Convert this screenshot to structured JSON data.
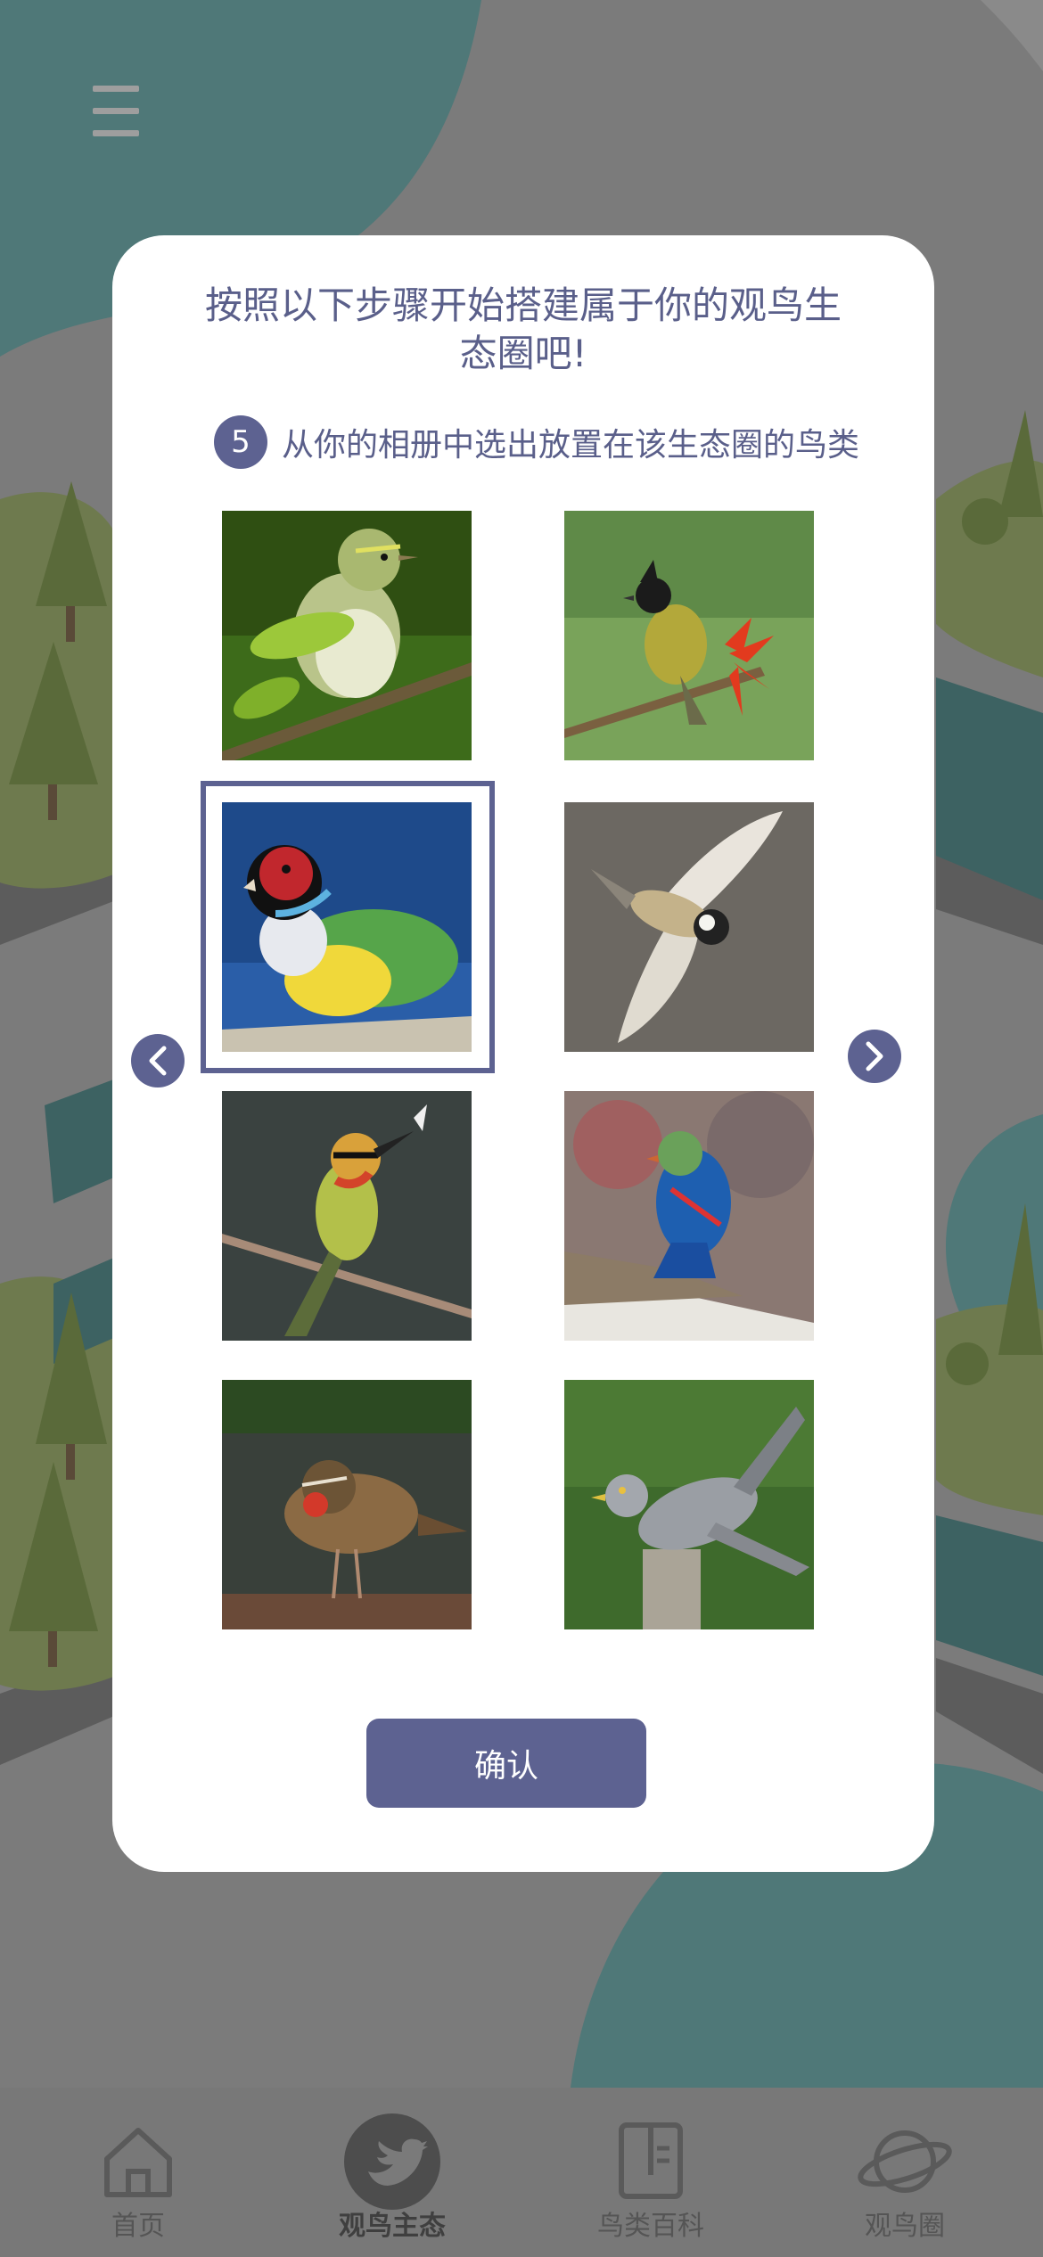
{
  "menu": {
    "icon": "hamburger-menu-icon"
  },
  "modal": {
    "title": "按照以下步骤开始搭建属于你的观鸟生态圈吧!",
    "step": {
      "number": "5",
      "text": "从你的相册中选出放置在该生态圈的鸟类"
    },
    "photos": [
      {
        "subject": "green-yellow warbler on branch"
      },
      {
        "subject": "black-crested bulbul with red flower"
      },
      {
        "subject": "gouldian finch",
        "selected": true
      },
      {
        "subject": "tit in flight"
      },
      {
        "subject": "bee-eater with insect"
      },
      {
        "subject": "blue-green bird on log"
      },
      {
        "subject": "rubythroat on ground"
      },
      {
        "subject": "cuckoo on post"
      }
    ],
    "prev_icon": "chevron-left-icon",
    "next_icon": "chevron-right-icon",
    "confirm_label": "确认"
  },
  "tabs": [
    {
      "label": "首页",
      "icon": "home-icon",
      "active": false
    },
    {
      "label": "观鸟主态",
      "icon": "bird-icon",
      "active": true
    },
    {
      "label": "鸟类百科",
      "icon": "book-icon",
      "active": false
    },
    {
      "label": "观鸟圈",
      "icon": "planet-icon",
      "active": false
    }
  ],
  "colors": {
    "accent": "#5d6291",
    "modal_bg": "#ffffff",
    "overlay": "#7a7a7a"
  }
}
